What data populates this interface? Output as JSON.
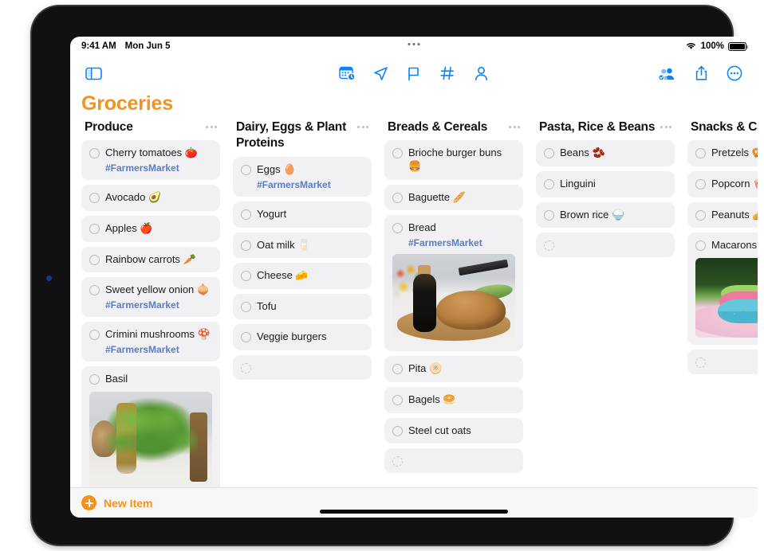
{
  "status_bar": {
    "time": "9:41 AM",
    "date": "Mon Jun 5",
    "wifi_icon": "wifi-icon",
    "battery_percent": "100%",
    "dots_icon": "multitask-dots-icon"
  },
  "toolbar": {
    "sidebar_toggle_icon": "sidebar-toggle-icon",
    "center_icons": [
      {
        "name": "calendar-reminder-icon"
      },
      {
        "name": "location-arrow-icon"
      },
      {
        "name": "flag-icon"
      },
      {
        "name": "hashtag-icon"
      },
      {
        "name": "person-icon"
      }
    ],
    "right_icons": [
      {
        "name": "collaborate-icon"
      },
      {
        "name": "share-icon"
      },
      {
        "name": "more-options-icon"
      }
    ]
  },
  "page_title": "Groceries",
  "accent_color": "#f5921e",
  "tint_color": "#0a84ff",
  "tag_color": "#5b7bc4",
  "columns": [
    {
      "title": "Produce",
      "menu_icon": "column-menu-icon",
      "items": [
        {
          "label": "Cherry tomatoes 🍅",
          "tag": "#FarmersMarket"
        },
        {
          "label": "Avocado 🥑"
        },
        {
          "label": "Apples 🍎"
        },
        {
          "label": "Rainbow carrots 🥕"
        },
        {
          "label": "Sweet yellow onion 🧅",
          "tag": "#FarmersMarket"
        },
        {
          "label": "Crimini mushrooms 🍄",
          "tag": "#FarmersMarket"
        },
        {
          "label": "Basil",
          "photo": "basil"
        },
        {
          "label": "",
          "placeholder": true
        }
      ]
    },
    {
      "title": "Dairy, Eggs & Plant Proteins",
      "menu_icon": "column-menu-icon",
      "items": [
        {
          "label": "Eggs 🥚",
          "tag": "#FarmersMarket"
        },
        {
          "label": "Yogurt"
        },
        {
          "label": "Oat milk 🥛"
        },
        {
          "label": "Cheese 🧀"
        },
        {
          "label": "Tofu"
        },
        {
          "label": "Veggie burgers"
        },
        {
          "label": "",
          "placeholder": true
        }
      ]
    },
    {
      "title": "Breads & Cereals",
      "menu_icon": "column-menu-icon",
      "items": [
        {
          "label": "Brioche burger buns 🍔"
        },
        {
          "label": "Baguette 🥖"
        },
        {
          "label": "Bread",
          "tag": "#FarmersMarket",
          "photo": "bread"
        },
        {
          "label": "Pita 🫓"
        },
        {
          "label": "Bagels 🥯"
        },
        {
          "label": "Steel cut oats"
        },
        {
          "label": "",
          "placeholder": true
        }
      ]
    },
    {
      "title": "Pasta, Rice & Beans",
      "menu_icon": "column-menu-icon",
      "items": [
        {
          "label": "Beans 🫘"
        },
        {
          "label": "Linguini"
        },
        {
          "label": "Brown rice 🍚"
        },
        {
          "label": "",
          "placeholder": true
        }
      ]
    },
    {
      "title": "Snacks & Candy",
      "menu_icon": "column-menu-icon",
      "items": [
        {
          "label": "Pretzels 🥨"
        },
        {
          "label": "Popcorn 🍿"
        },
        {
          "label": "Peanuts 🥜"
        },
        {
          "label": "Macarons",
          "photo": "macaron"
        },
        {
          "label": "",
          "placeholder": true
        }
      ]
    }
  ],
  "bottom_bar": {
    "new_item_label": "New Item",
    "plus_icon": "plus-circle-icon"
  }
}
